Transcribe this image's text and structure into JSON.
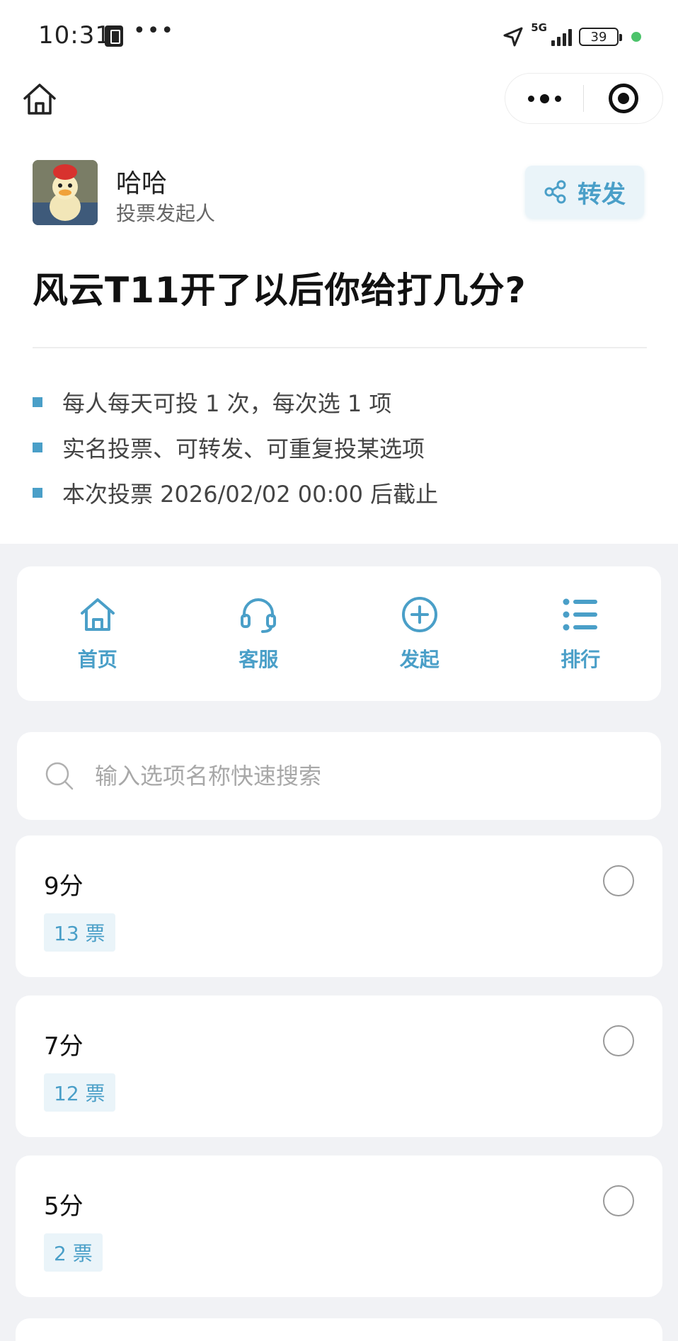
{
  "status_bar": {
    "time": "10:31",
    "more": "•••",
    "network": "5G",
    "battery": "39"
  },
  "author": {
    "name": "哈哈",
    "role": "投票发起人"
  },
  "share": {
    "label": "转发"
  },
  "poll": {
    "title": "风云T11开了以后你给打几分?",
    "rules": [
      "每人每天可投 1 次，每次选 1 项",
      "实名投票、可转发、可重复投某选项",
      "本次投票 2026/02/02 00:00 后截止"
    ]
  },
  "quick_nav": [
    {
      "label": "首页",
      "icon": "home-icon"
    },
    {
      "label": "客服",
      "icon": "headset-icon"
    },
    {
      "label": "发起",
      "icon": "plus-circle-icon"
    },
    {
      "label": "排行",
      "icon": "ranking-list-icon"
    }
  ],
  "search": {
    "placeholder": "输入选项名称快速搜索"
  },
  "options": [
    {
      "name": "9分",
      "votes": "13 票"
    },
    {
      "name": "7分",
      "votes": "12 票"
    },
    {
      "name": "5分",
      "votes": "2 票"
    }
  ],
  "colors": {
    "accent": "#4a9fc8",
    "accent_bg": "#eaf4f9",
    "page_bg": "#f1f2f5"
  }
}
